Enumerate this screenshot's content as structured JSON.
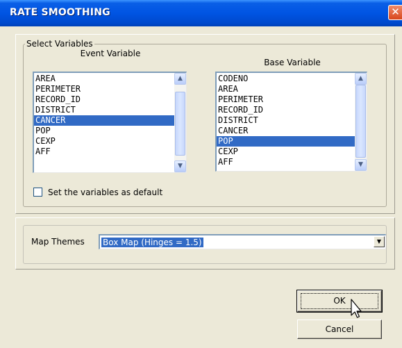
{
  "window": {
    "title": "RATE SMOOTHING",
    "close_glyph": "✕"
  },
  "variables": {
    "group_label": "Select Variables",
    "event": {
      "heading": "Event Variable",
      "items": [
        "AREA",
        "PERIMETER",
        "RECORD_ID",
        "DISTRICT",
        "CANCER",
        "POP",
        "CEXP",
        "AFF"
      ],
      "selected": "CANCER"
    },
    "base": {
      "heading": "Base Variable",
      "items": [
        "CODENO",
        "AREA",
        "PERIMETER",
        "RECORD_ID",
        "DISTRICT",
        "CANCER",
        "POP",
        "CEXP",
        "AFF"
      ],
      "selected": "POP"
    },
    "default_checkbox": {
      "label": "Set the variables as default",
      "checked": false
    }
  },
  "map_themes": {
    "label": "Map Themes",
    "selected": "Box Map (Hinges = 1.5)"
  },
  "buttons": {
    "ok": "OK",
    "cancel": "Cancel"
  },
  "colors": {
    "titlebar": "#0054e3",
    "selection": "#316ac5",
    "dialog_bg": "#ece9d8"
  },
  "icons": {
    "scroll_up": "▲",
    "scroll_down": "▼",
    "dropdown": "▼"
  }
}
